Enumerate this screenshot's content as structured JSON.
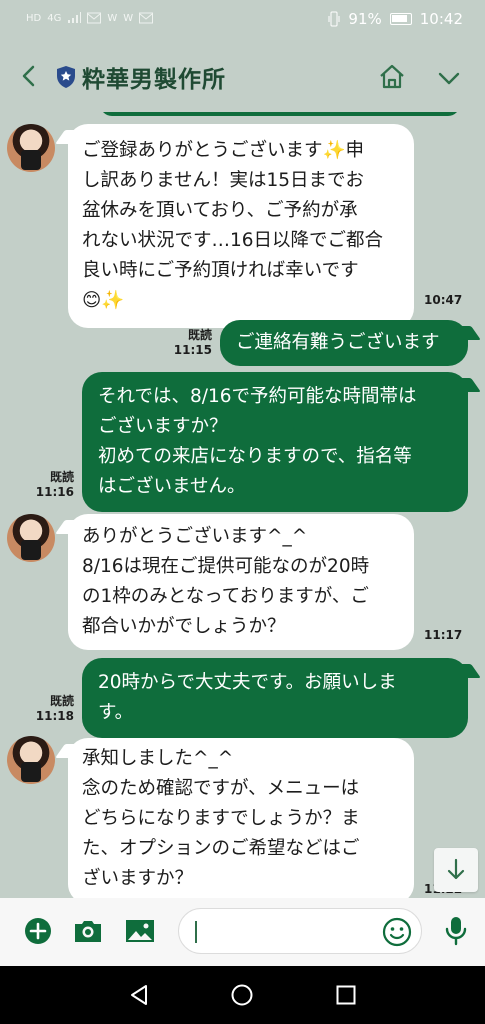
{
  "status": {
    "left_icons": [
      "HD",
      "4G",
      "signal",
      "mail",
      "W",
      "W",
      "mail"
    ],
    "battery_percent": "91%",
    "time": "10:42"
  },
  "header": {
    "title": "粋華男製作所",
    "icons": [
      "back-icon",
      "shield-icon",
      "home-icon",
      "chevron-down-icon"
    ]
  },
  "colors": {
    "background": "#c3cfc8",
    "outgoing_bubble": "#0f6d3c",
    "incoming_bubble": "#ffffff",
    "accent": "#2f6f4a"
  },
  "messages": [
    {
      "dir": "in",
      "lines": [
        "ご登録ありがとうございます✨申",
        "し訳ありません！実は15日までお",
        "盆休みを頂いており、ご予約が承",
        "れない状況です…16日以降でご都合",
        "良い時にご予約頂ければ幸いです",
        "😊✨"
      ],
      "time": "10:47"
    },
    {
      "dir": "out",
      "lines": [
        "ご連絡有難うございます"
      ],
      "read": "既読",
      "time": "11:15"
    },
    {
      "dir": "out",
      "lines": [
        "それでは、8/16で予約可能な時間帯は",
        "ございますか？",
        "初めての来店になりますので、指名等",
        "はございません。"
      ],
      "read": "既読",
      "time": "11:16"
    },
    {
      "dir": "in",
      "lines": [
        "ありがとうございます^_^",
        "8/16は現在ご提供可能なのが20時",
        "の1枠のみとなっておりますが、ご",
        "都合いかがでしょうか？"
      ],
      "time": "11:17"
    },
    {
      "dir": "out",
      "lines": [
        "20時からで大丈夫です。お願いしま",
        "す。"
      ],
      "read": "既読",
      "time": "11:18"
    },
    {
      "dir": "in",
      "lines": [
        "承知しました^_^",
        "念のため確認ですが、メニューは",
        "どちらになりますでしょうか？ま",
        "た、オプションのご希望などはご",
        "ざいますか？"
      ],
      "time": "11:22"
    }
  ],
  "input": {
    "placeholder": "",
    "icons": [
      "plus-icon",
      "camera-icon",
      "image-icon",
      "emoji-icon",
      "mic-icon"
    ]
  },
  "nav": {
    "icons": [
      "back-triangle-icon",
      "home-circle-icon",
      "recent-square-icon"
    ]
  }
}
